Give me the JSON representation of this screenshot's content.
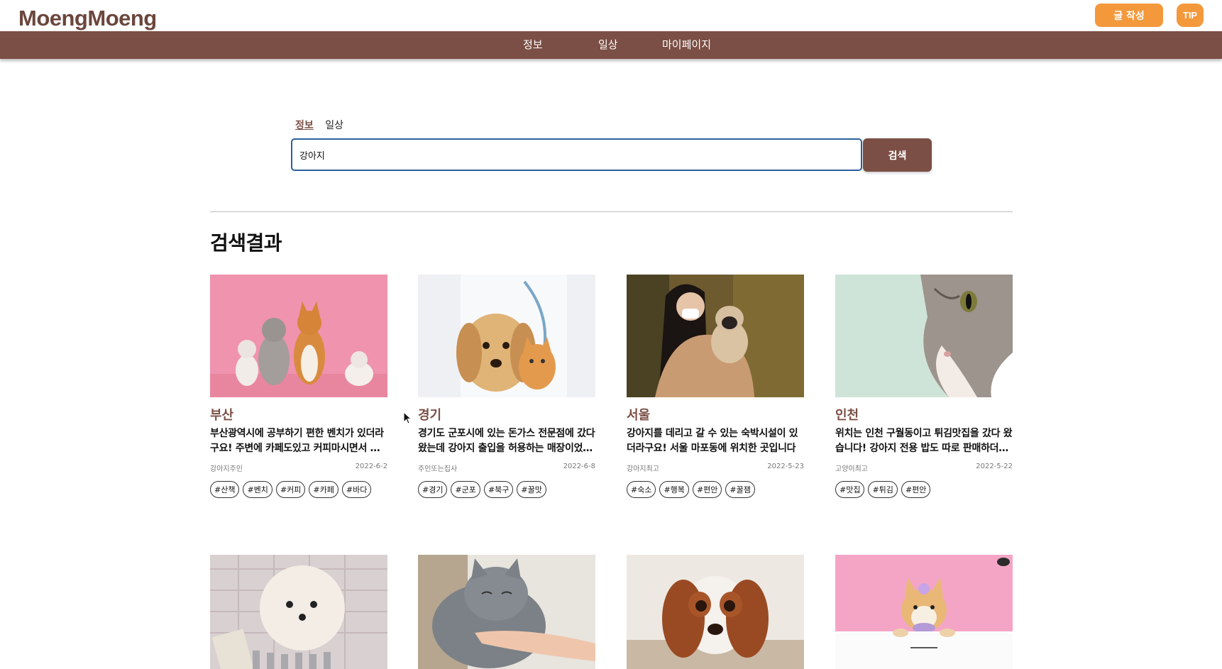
{
  "header": {
    "logo": "MoengMoeng",
    "write_button": "글 작성",
    "tip_button": "TIP"
  },
  "nav": {
    "items": [
      "정보",
      "일상",
      "마이페이지"
    ]
  },
  "search": {
    "tabs": [
      "정보",
      "일상"
    ],
    "active_tab": "정보",
    "value": "강아지",
    "button": "검색"
  },
  "results": {
    "title": "검색결과",
    "cards": [
      {
        "region": "부산",
        "text": "부산광역시에 공부하기 편한 벤치가 있더라구요! 주변에 카페도있고 커피마시면서 공부하기 좋아요",
        "author": "강아지주인",
        "date": "2022-6-2",
        "tags": [
          "#산책",
          "#벤치",
          "#커피",
          "#카페",
          "#바다"
        ],
        "image": "pink-background-dogs-and-cats-photo"
      },
      {
        "region": "경기",
        "text": "경기도 군포시에 있는 돈가스 전문점에 갔다왔는데 강아지 출입을 허용하는 매장이었어요",
        "author": "주인또는집사",
        "date": "2022-6-8",
        "tags": [
          "#경기",
          "#군포",
          "#북구",
          "#꿀맛"
        ],
        "image": "vet-with-puppy-and-kitten-photo"
      },
      {
        "region": "서울",
        "text": "강아지를 데리고 갈 수 있는 숙박시설이 있더라구요! 서울 마포동에 위치한 곳입니다",
        "author": "강아지최고",
        "date": "2022-5-23",
        "tags": [
          "#숙소",
          "#행복",
          "#편안",
          "#꿀잼"
        ],
        "image": "woman-hugging-pug-photo"
      },
      {
        "region": "인천",
        "text": "위치는 인천 구월동이고 튀김맛집을 갔다 왔습니다! 강아지 전용 밥도 따로 판매하더라구요",
        "author": "고양이최고",
        "date": "2022-5-22",
        "tags": [
          "#맛집",
          "#튀김",
          "#편안"
        ],
        "image": "cat-closeup-photo"
      },
      {
        "region": "",
        "text": "",
        "author": "",
        "date": "",
        "tags": [],
        "image": "white-pomeranian-photo"
      },
      {
        "region": "",
        "text": "",
        "author": "",
        "date": "",
        "tags": [],
        "image": "gray-cat-with-hand-photo"
      },
      {
        "region": "",
        "text": "",
        "author": "",
        "date": "",
        "tags": [],
        "image": "spaniel-lying-on-rug-photo"
      },
      {
        "region": "",
        "text": "",
        "author": "",
        "date": "",
        "tags": [],
        "image": "corgi-pink-poster-photo"
      }
    ]
  }
}
